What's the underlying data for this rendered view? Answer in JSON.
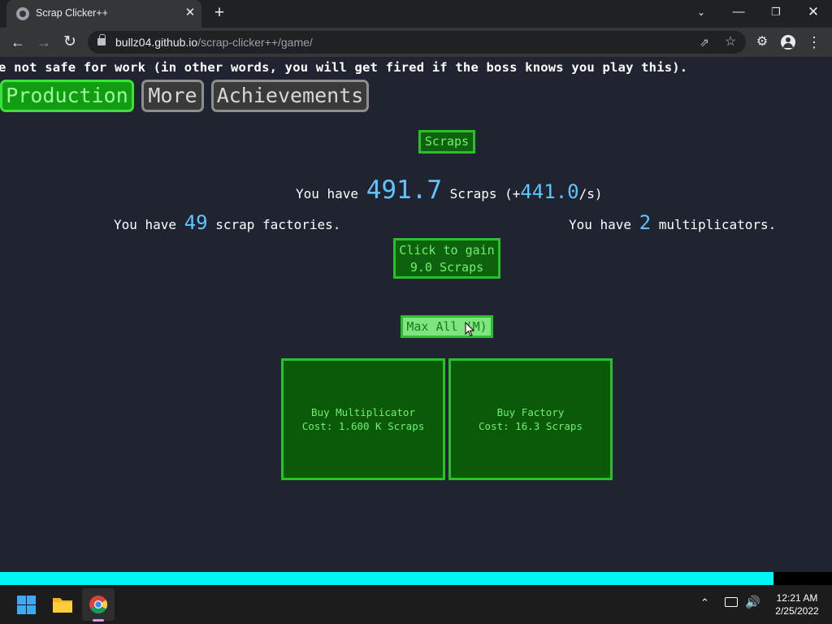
{
  "browser": {
    "tab_title": "Scrap Clicker++",
    "tab_close": "✕",
    "new_tab": "+",
    "url_host": "bullz04.github.io",
    "url_path": "/scrap-clicker++/game/",
    "icons": [
      "favicon-globe",
      "back-arrow",
      "forward-arrow",
      "reload",
      "lock",
      "share",
      "star",
      "extensions",
      "profile",
      "menu"
    ]
  },
  "game": {
    "warning_text": "e not safe for work (in other words, you will get fired if the boss knows you play this).",
    "tabs": [
      {
        "label": "Production",
        "active": true
      },
      {
        "label": "More",
        "active": false
      },
      {
        "label": "Achievements",
        "active": false
      }
    ],
    "scraps_button": "Scraps",
    "scraps_prefix": "You have ",
    "scraps_value": "491.7",
    "scraps_suffix_a": " Scraps (+",
    "scraps_rate": "441.0",
    "scraps_suffix_b": "/s)",
    "factories_prefix": "You have ",
    "factories_value": "49",
    "factories_suffix": " scrap factories.",
    "multi_prefix": "You have ",
    "multi_value": "2",
    "multi_suffix": " multiplicators.",
    "gain_line1": "Click to gain",
    "gain_line2": "9.0 Scraps",
    "max_all": "Max All (M)",
    "buy_multi_title": "Buy Multiplicator",
    "buy_multi_cost": "Cost: 1.600 K Scraps",
    "buy_factory_title": "Buy Factory",
    "buy_factory_cost": "Cost: 16.3 Scraps",
    "progress_fraction": 0.93,
    "accent_green": "#2bc02b",
    "value_blue": "#5fc4ff",
    "progress_color": "#00f5f5"
  },
  "taskbar": {
    "time": "12:21 AM",
    "date": "2/25/2022",
    "apps": [
      "windows-start",
      "file-explorer",
      "chrome"
    ]
  }
}
